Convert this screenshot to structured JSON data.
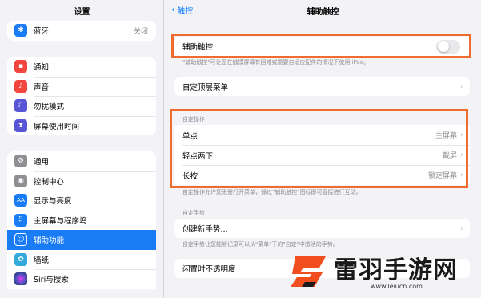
{
  "sidebar": {
    "title": "设置",
    "group1": [
      {
        "label": "蓝牙",
        "value": "关闭",
        "icon": "bluetooth-icon",
        "color": "#1a7cf5",
        "glyph": "✱"
      }
    ],
    "group2": [
      {
        "label": "通知",
        "icon": "notification-icon",
        "color": "#f2453d",
        "glyph": "▪"
      },
      {
        "label": "声音",
        "icon": "sound-icon",
        "color": "#f2453d",
        "glyph": "♪"
      },
      {
        "label": "勿扰模式",
        "icon": "moon-icon",
        "color": "#5856d6",
        "glyph": "☾"
      },
      {
        "label": "屏幕使用时间",
        "icon": "hourglass-icon",
        "color": "#5856d6",
        "glyph": "⧗"
      }
    ],
    "group3": [
      {
        "label": "通用",
        "icon": "gear-icon",
        "color": "#8e8e93",
        "glyph": "⚙"
      },
      {
        "label": "控制中心",
        "icon": "control-center-icon",
        "color": "#8e8e93",
        "glyph": "◉"
      },
      {
        "label": "显示与亮度",
        "icon": "display-brightness-icon",
        "color": "#1a7cf5",
        "glyph": "AA"
      },
      {
        "label": "主屏幕与程序坞",
        "icon": "home-screen-icon",
        "color": "#1a7cf5",
        "glyph": "⠿"
      },
      {
        "label": "辅助功能",
        "icon": "accessibility-icon",
        "color": "#1a7cf5",
        "glyph": "☺",
        "active": true
      },
      {
        "label": "墙纸",
        "icon": "wallpaper-icon",
        "color": "#34aadc",
        "glyph": "✿"
      },
      {
        "label": "Siri与搜索",
        "icon": "siri-icon",
        "color": "#1c1c3a",
        "glyph": "◍"
      }
    ]
  },
  "detail": {
    "back_label": "触控",
    "title": "辅助触控",
    "assistive_touch_label": "辅助触控",
    "assistive_touch_on": false,
    "assistive_touch_note": "\"辅助触控\"可让您在触摸屏幕有困难或需要自适应配件的情况下使用 iPad。",
    "custom_top_menu_label": "自定顶层菜单",
    "custom_actions_header": "自定操作",
    "custom_actions": [
      {
        "label": "单点",
        "value": "主屏幕"
      },
      {
        "label": "轻点两下",
        "value": "截屏"
      },
      {
        "label": "长按",
        "value": "锁定屏幕"
      }
    ],
    "custom_actions_note": "自定操作允许您无需打开菜单，通过\"辅助触控\"图标即可直接进行互动。",
    "custom_gestures_header": "自定手势",
    "create_gesture_label": "创建新手势...",
    "custom_gestures_note": "自定手势让您能够记录可以从\"菜单\"下的\"自定\"中激活的手势。",
    "idle_opacity_label": "闲置时不透明度"
  },
  "watermark": {
    "text": "雷羽手游网",
    "url": "www.leiucn.com"
  },
  "colors": {
    "highlight": "#ef6b2f",
    "accent": "#0a7aff",
    "active_row": "#1a7cf5"
  }
}
